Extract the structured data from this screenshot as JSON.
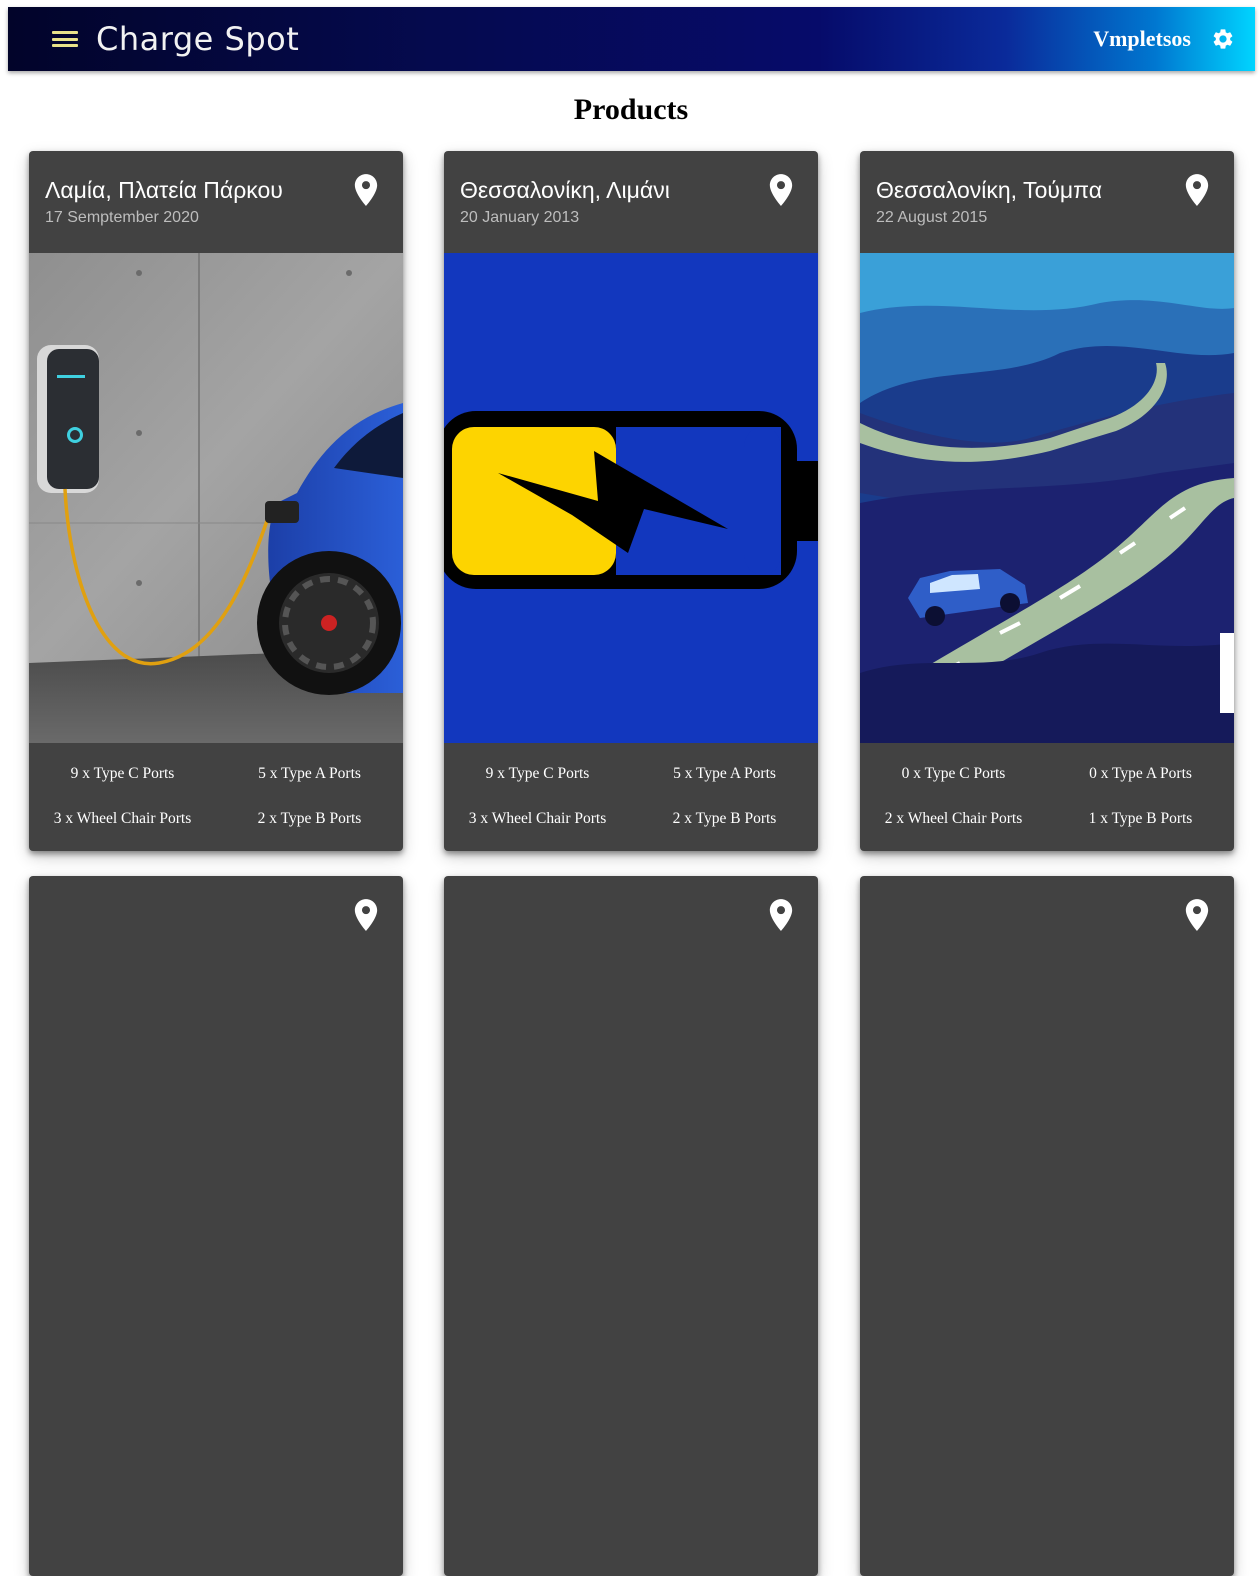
{
  "appbar": {
    "brand": "Charge Spot",
    "username": "Vmpletsos",
    "menu_icon": "menu-icon",
    "settings_icon": "gear-icon"
  },
  "page": {
    "title": "Products"
  },
  "cards": [
    {
      "title": "Λαμία, Πλατεία Πάρκου",
      "date": "17 Semptember 2020",
      "image": "ev-charging-car-photo",
      "ports": [
        "9 x Type C Ports",
        "5 x Type A Ports",
        "3 x Wheel Chair Ports",
        "2 x Type B Ports"
      ]
    },
    {
      "title": "Θεσσαλονίκη, Λιμάνι",
      "date": "20 January 2013",
      "image": "battery-charging-illustration",
      "ports": [
        "9 x Type C Ports",
        "5 x Type A Ports",
        "3 x Wheel Chair Ports",
        "2 x Type B Ports"
      ]
    },
    {
      "title": "Θεσσαλονίκη, Τούμπα",
      "date": "22 August 2015",
      "image": "mountain-road-car-illustration",
      "ports": [
        "0 x Type C Ports",
        "0 x Type A Ports",
        "2 x Wheel Chair Ports",
        "1 x Type B Ports"
      ]
    }
  ],
  "colors": {
    "card_bg": "#424242",
    "appbar_start": "#02042a",
    "appbar_end": "#00d4ff",
    "menu_icon": "#e8e28a"
  }
}
